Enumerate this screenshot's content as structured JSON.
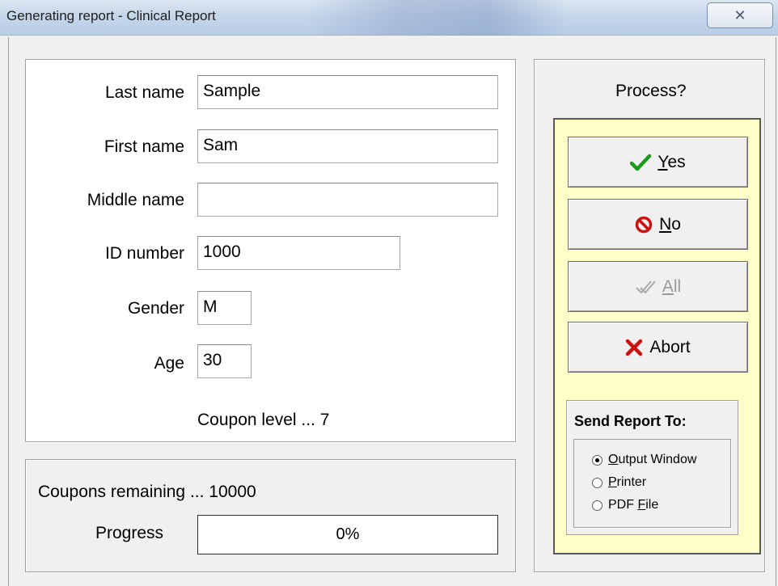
{
  "window": {
    "title": "Generating report - Clinical Report",
    "close_glyph": "✕"
  },
  "patient": {
    "last_name_label": "Last name",
    "last_name_value": "Sample",
    "first_name_label": "First name",
    "first_name_value": "Sam",
    "middle_name_label": "Middle name",
    "middle_name_value": "",
    "id_label": "ID number",
    "id_value": "1000",
    "gender_label": "Gender",
    "gender_value": "M",
    "age_label": "Age",
    "age_value": "30",
    "coupon_level": "Coupon level ... 7"
  },
  "coupons": {
    "remaining": "Coupons remaining ... 10000",
    "progress_label": "Progress",
    "progress_text": "0%",
    "progress_value": 0
  },
  "process": {
    "title": "Process?",
    "buttons": {
      "yes": {
        "prefix": "",
        "accel": "Y",
        "suffix": "es",
        "icon": "checkmark-icon",
        "color": "#1a9a1a",
        "enabled": true
      },
      "no": {
        "prefix": "",
        "accel": "N",
        "suffix": "o",
        "icon": "no-entry-icon",
        "color": "#cc1111",
        "enabled": true
      },
      "all": {
        "prefix": "",
        "accel": "A",
        "suffix": "ll",
        "icon": "double-check-icon",
        "color": "#9a9a9a",
        "enabled": false
      },
      "abort": {
        "label": "Abort",
        "icon": "x-mark-icon",
        "color": "#cc1111",
        "enabled": true
      }
    },
    "panel_color": "#ffffc8"
  },
  "send_report": {
    "title": "Send Report To:",
    "options": [
      {
        "accel": "O",
        "rest": "utput Window",
        "checked": true
      },
      {
        "accel": "P",
        "rest": "rinter",
        "checked": false
      },
      {
        "pre": "PDF ",
        "accel": "F",
        "rest": "ile",
        "checked": false
      }
    ]
  }
}
